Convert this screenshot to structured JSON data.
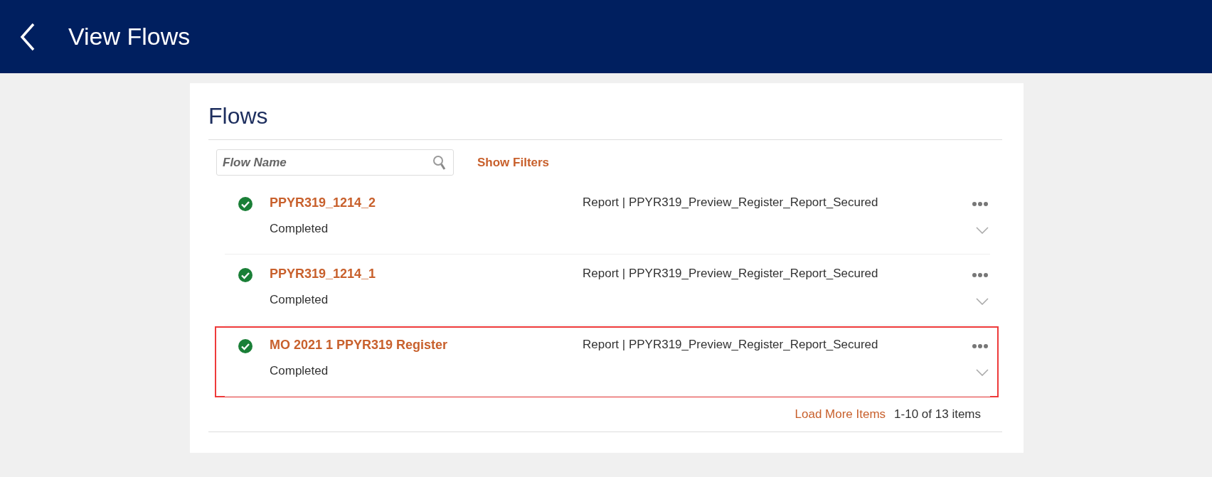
{
  "header": {
    "title": "View Flows"
  },
  "panel": {
    "title": "Flows",
    "search": {
      "placeholder": "Flow Name"
    },
    "filters_link": "Show Filters"
  },
  "flows": [
    {
      "name": "PPYR319_1214_2",
      "status": "Completed",
      "detail": "Report | PPYR319_Preview_Register_Report_Secured",
      "highlighted": false
    },
    {
      "name": "PPYR319_1214_1",
      "status": "Completed",
      "detail": "Report | PPYR319_Preview_Register_Report_Secured",
      "highlighted": false
    },
    {
      "name": "MO 2021 1 PPYR319 Register",
      "status": "Completed",
      "detail": "Report | PPYR319_Preview_Register_Report_Secured",
      "highlighted": true
    }
  ],
  "footer": {
    "load_more": "Load More Items",
    "count": "1-10 of 13 items"
  }
}
